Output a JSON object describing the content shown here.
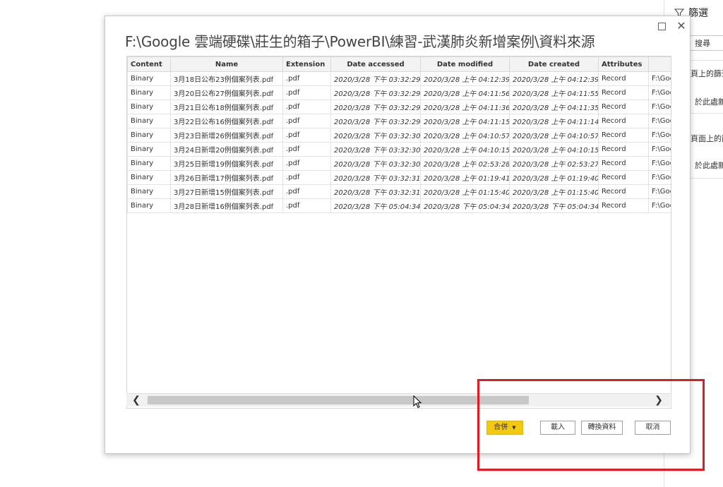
{
  "filter_pane": {
    "title": "篩選",
    "search_placeholder": "搜尋",
    "texts": [
      "頁上的篩選",
      "於此處新",
      "頁面上的篩",
      "於此處新"
    ]
  },
  "dialog": {
    "title": "F:\\Google 雲端硬碟\\莊生的箱子\\PowerBI\\練習-武漢肺炎新增案例\\資料來源",
    "maximize": "□",
    "close": "✕"
  },
  "table": {
    "columns": [
      "Content",
      "Name",
      "Extension",
      "Date accessed",
      "Date modified",
      "Date created",
      "Attributes",
      ""
    ],
    "rows": [
      [
        "Binary",
        "3月18日公布23例個案列表.pdf",
        ".pdf",
        "2020/3/28 下午 03:32:29",
        "2020/3/28 上午 04:12:39",
        "2020/3/28 上午 04:12:39",
        "Record",
        "F:\\Goo"
      ],
      [
        "Binary",
        "3月20日公布27例個案列表.pdf",
        ".pdf",
        "2020/3/28 下午 03:32:29",
        "2020/3/28 上午 04:11:56",
        "2020/3/28 上午 04:11:55",
        "Record",
        "F:\\Goo"
      ],
      [
        "Binary",
        "3月21日公布18例個案列表.pdf",
        ".pdf",
        "2020/3/28 下午 03:32:29",
        "2020/3/28 上午 04:11:36",
        "2020/3/28 上午 04:11:35",
        "Record",
        "F:\\Goo"
      ],
      [
        "Binary",
        "3月22日公布16例個案列表.pdf",
        ".pdf",
        "2020/3/28 下午 03:32:29",
        "2020/3/28 上午 04:11:15",
        "2020/3/28 上午 04:11:14",
        "Record",
        "F:\\Goo"
      ],
      [
        "Binary",
        "3月23日新增26例個案列表.pdf",
        ".pdf",
        "2020/3/28 下午 03:32:30",
        "2020/3/28 上午 04:10:57",
        "2020/3/28 上午 04:10:57",
        "Record",
        "F:\\Goo"
      ],
      [
        "Binary",
        "3月24日新增20例個案列表.pdf",
        ".pdf",
        "2020/3/28 下午 03:32:30",
        "2020/3/28 上午 04:10:15",
        "2020/3/28 上午 04:10:15",
        "Record",
        "F:\\Goo"
      ],
      [
        "Binary",
        "3月25日新增19例個案列表.pdf",
        ".pdf",
        "2020/3/28 下午 03:32:30",
        "2020/3/28 上午 02:53:28",
        "2020/3/28 上午 02:53:27",
        "Record",
        "F:\\Goo"
      ],
      [
        "Binary",
        "3月26日新增17例個案列表.pdf",
        ".pdf",
        "2020/3/28 下午 03:32:31",
        "2020/3/28 上午 01:19:41",
        "2020/3/28 上午 01:19:40",
        "Record",
        "F:\\Goo"
      ],
      [
        "Binary",
        "3月27日新增15例個案列表.pdf",
        ".pdf",
        "2020/3/28 下午 03:32:31",
        "2020/3/28 上午 01:15:40",
        "2020/3/28 上午 01:15:40",
        "Record",
        "F:\\Goo"
      ],
      [
        "Binary",
        "3月28日新增16例個案列表.pdf",
        ".pdf",
        "2020/3/28 下午 05:04:34",
        "2020/3/28 下午 05:04:34",
        "2020/3/28 下午 05:04:34",
        "Record",
        "F:\\Goo"
      ]
    ]
  },
  "buttons": {
    "combine": "合併",
    "load": "載入",
    "transform": "轉換資料",
    "cancel": "取消"
  },
  "colors": {
    "primary_button": "#f2c811",
    "highlight_box": "#e01b24"
  }
}
